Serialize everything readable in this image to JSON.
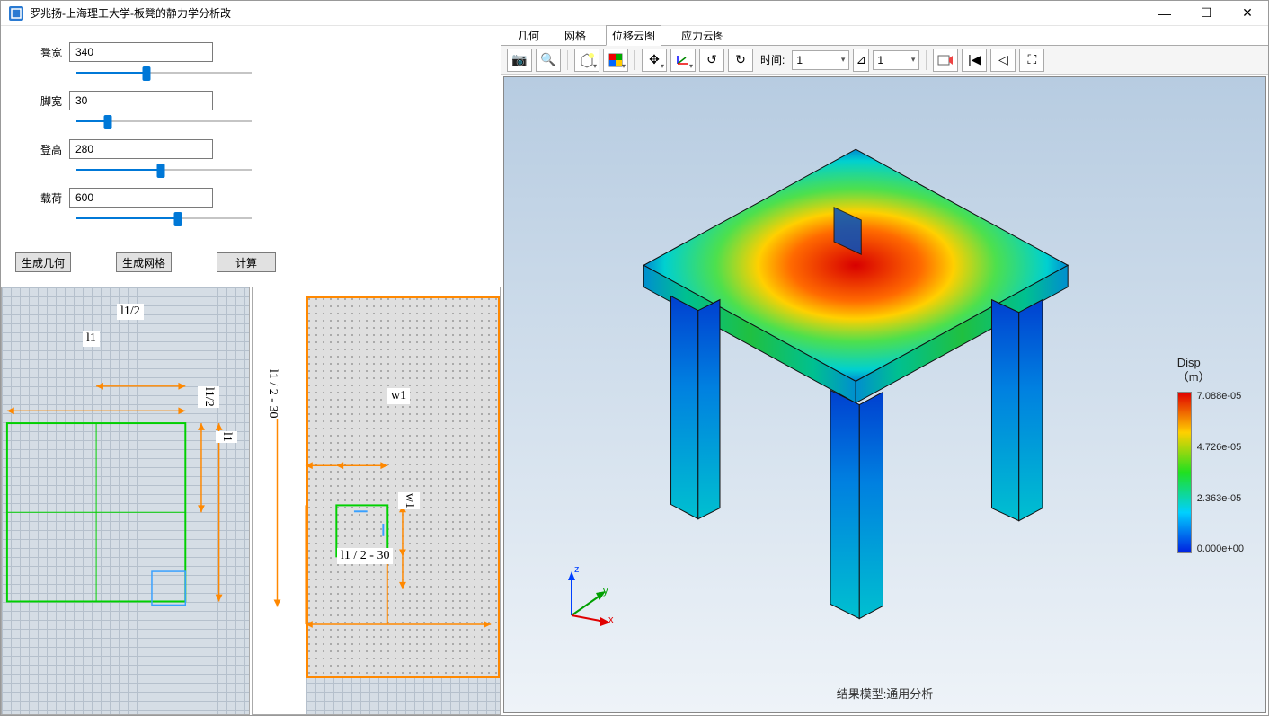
{
  "window": {
    "title": "罗兆扬-上海理工大学-板凳的静力学分析改"
  },
  "params": {
    "items": [
      {
        "label": "凳宽",
        "value": "340",
        "fill_pct": 40
      },
      {
        "label": "脚宽",
        "value": "30",
        "fill_pct": 18
      },
      {
        "label": "登高",
        "value": "280",
        "fill_pct": 48
      },
      {
        "label": "载荷",
        "value": "600",
        "fill_pct": 58
      }
    ]
  },
  "buttons": {
    "gen_geom": "生成几何",
    "gen_mesh": "生成网格",
    "compute": "计算"
  },
  "sketch": {
    "left_labels": {
      "l1_2": "l1/2",
      "l1": "l1",
      "l1_2v": "l1/2",
      "l1v": "l1"
    },
    "right_labels": {
      "l1_2_30_v": "l1 / 2  - 30",
      "w1": "w1",
      "w1v": "w1",
      "l1_2_30_h": "l1 / 2  - 30"
    }
  },
  "tabs": {
    "items": [
      "几何",
      "网格",
      "位移云图",
      "应力云图"
    ],
    "active_index": 2
  },
  "toolbar": {
    "time_label": "时间:",
    "time_combo": "1",
    "time_field": "1"
  },
  "viewport": {
    "caption": "结果模型:通用分析",
    "axes": {
      "x": "x",
      "y": "y",
      "z": "z"
    },
    "legend": {
      "title_line1": "Disp",
      "title_line2": "（m）",
      "ticks": [
        "7.088e-05",
        "4.726e-05",
        "2.363e-05",
        "0.000e+00"
      ]
    }
  },
  "chart_data": {
    "type": "heatmap",
    "title": "Disp (m) - 位移云图",
    "colormap": "rainbow",
    "value_range": [
      0.0,
      7.088e-05
    ],
    "colorbar_ticks": [
      0.0,
      2.363e-05,
      4.726e-05,
      7.088e-05
    ],
    "caption": "结果模型:通用分析",
    "geometry": "isometric view of a square stool: square top plate supported by 4 square legs",
    "field_description": "Displacement magnitude on top plate is highest (≈7.088e-05 m) at center, decreasing radially to ≈0 at the four corners above the legs; legs show near-zero displacement increasing slightly toward the bottom."
  }
}
